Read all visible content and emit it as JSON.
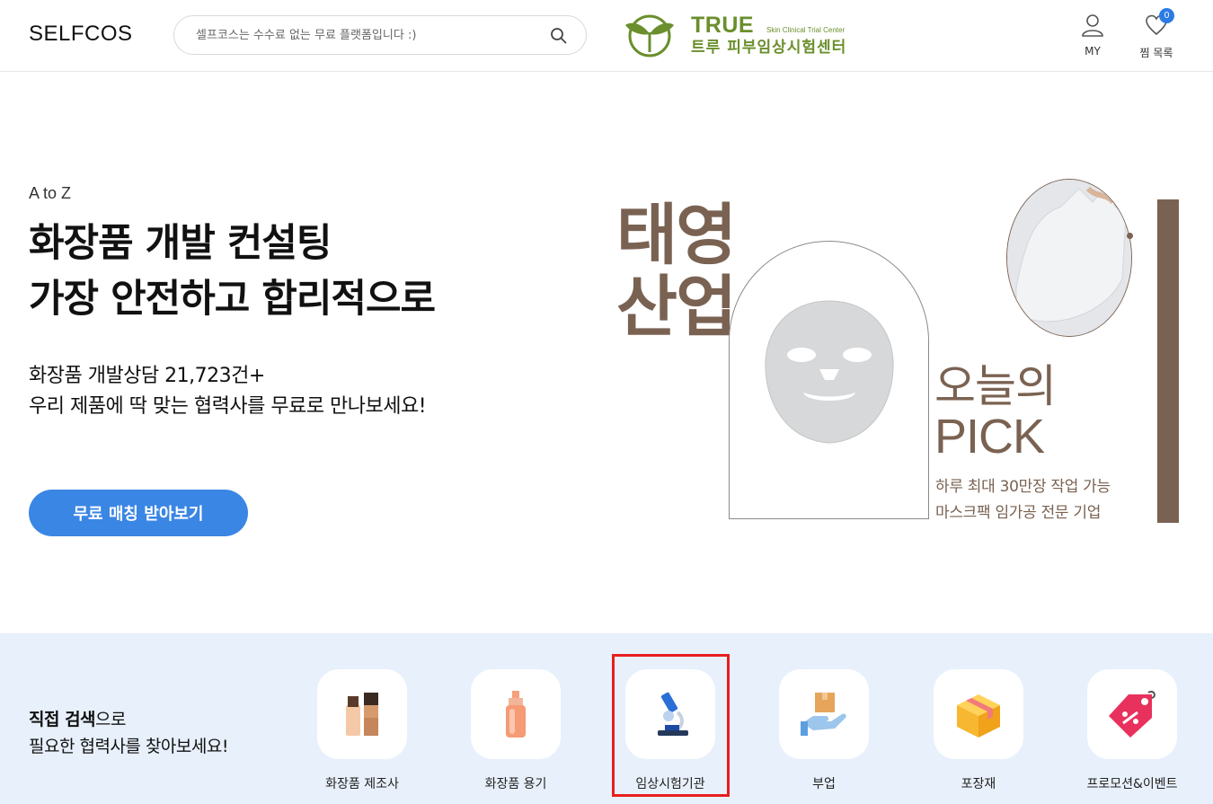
{
  "header": {
    "logo": "SELFCOS",
    "search_placeholder": "셀프코스는 수수료 없는 무료 플랫폼입니다 :)",
    "ad": {
      "name_en": "TRUE",
      "subtitle": "Skin Clinical Trial Center",
      "name_ko": "트루 피부임상시험센터"
    },
    "my_label": "MY",
    "wishlist_label": "찜 목록",
    "wishlist_count": "0"
  },
  "hero": {
    "eyebrow": "A to Z",
    "title_line1": "화장품 개발 컨설팅",
    "title_line2": "가장 안전하고 합리적으로",
    "desc_line1": "화장품 개발상담 21,723건+",
    "desc_line2": "우리 제품에 딱 맞는 협력사를 무료로 만나보세요!",
    "cta_label": "무료 매칭 받아보기"
  },
  "banner": {
    "company_line1": "태영",
    "company_line2": "산업",
    "pick_line1": "오늘의",
    "pick_line2": "PICK",
    "desc_line1": "하루 최대 30만장 작업 가능",
    "desc_line2": "마스크팩 임가공 전문 기업",
    "accent_color": "#7a6252"
  },
  "categories": {
    "intro_bold": "직접 검색",
    "intro_rest": "으로",
    "intro_line2": "필요한 협력사를 찾아보세요!",
    "items": [
      {
        "label": "화장품 제조사",
        "icon": "cosmetic-bottles-icon"
      },
      {
        "label": "화장품 용기",
        "icon": "pump-bottle-icon"
      },
      {
        "label": "임상시험기관",
        "icon": "microscope-icon",
        "highlighted": true
      },
      {
        "label": "부업",
        "icon": "hand-box-icon"
      },
      {
        "label": "포장재",
        "icon": "package-box-icon"
      },
      {
        "label": "프로모션&이벤트",
        "icon": "sale-tag-icon"
      }
    ]
  }
}
